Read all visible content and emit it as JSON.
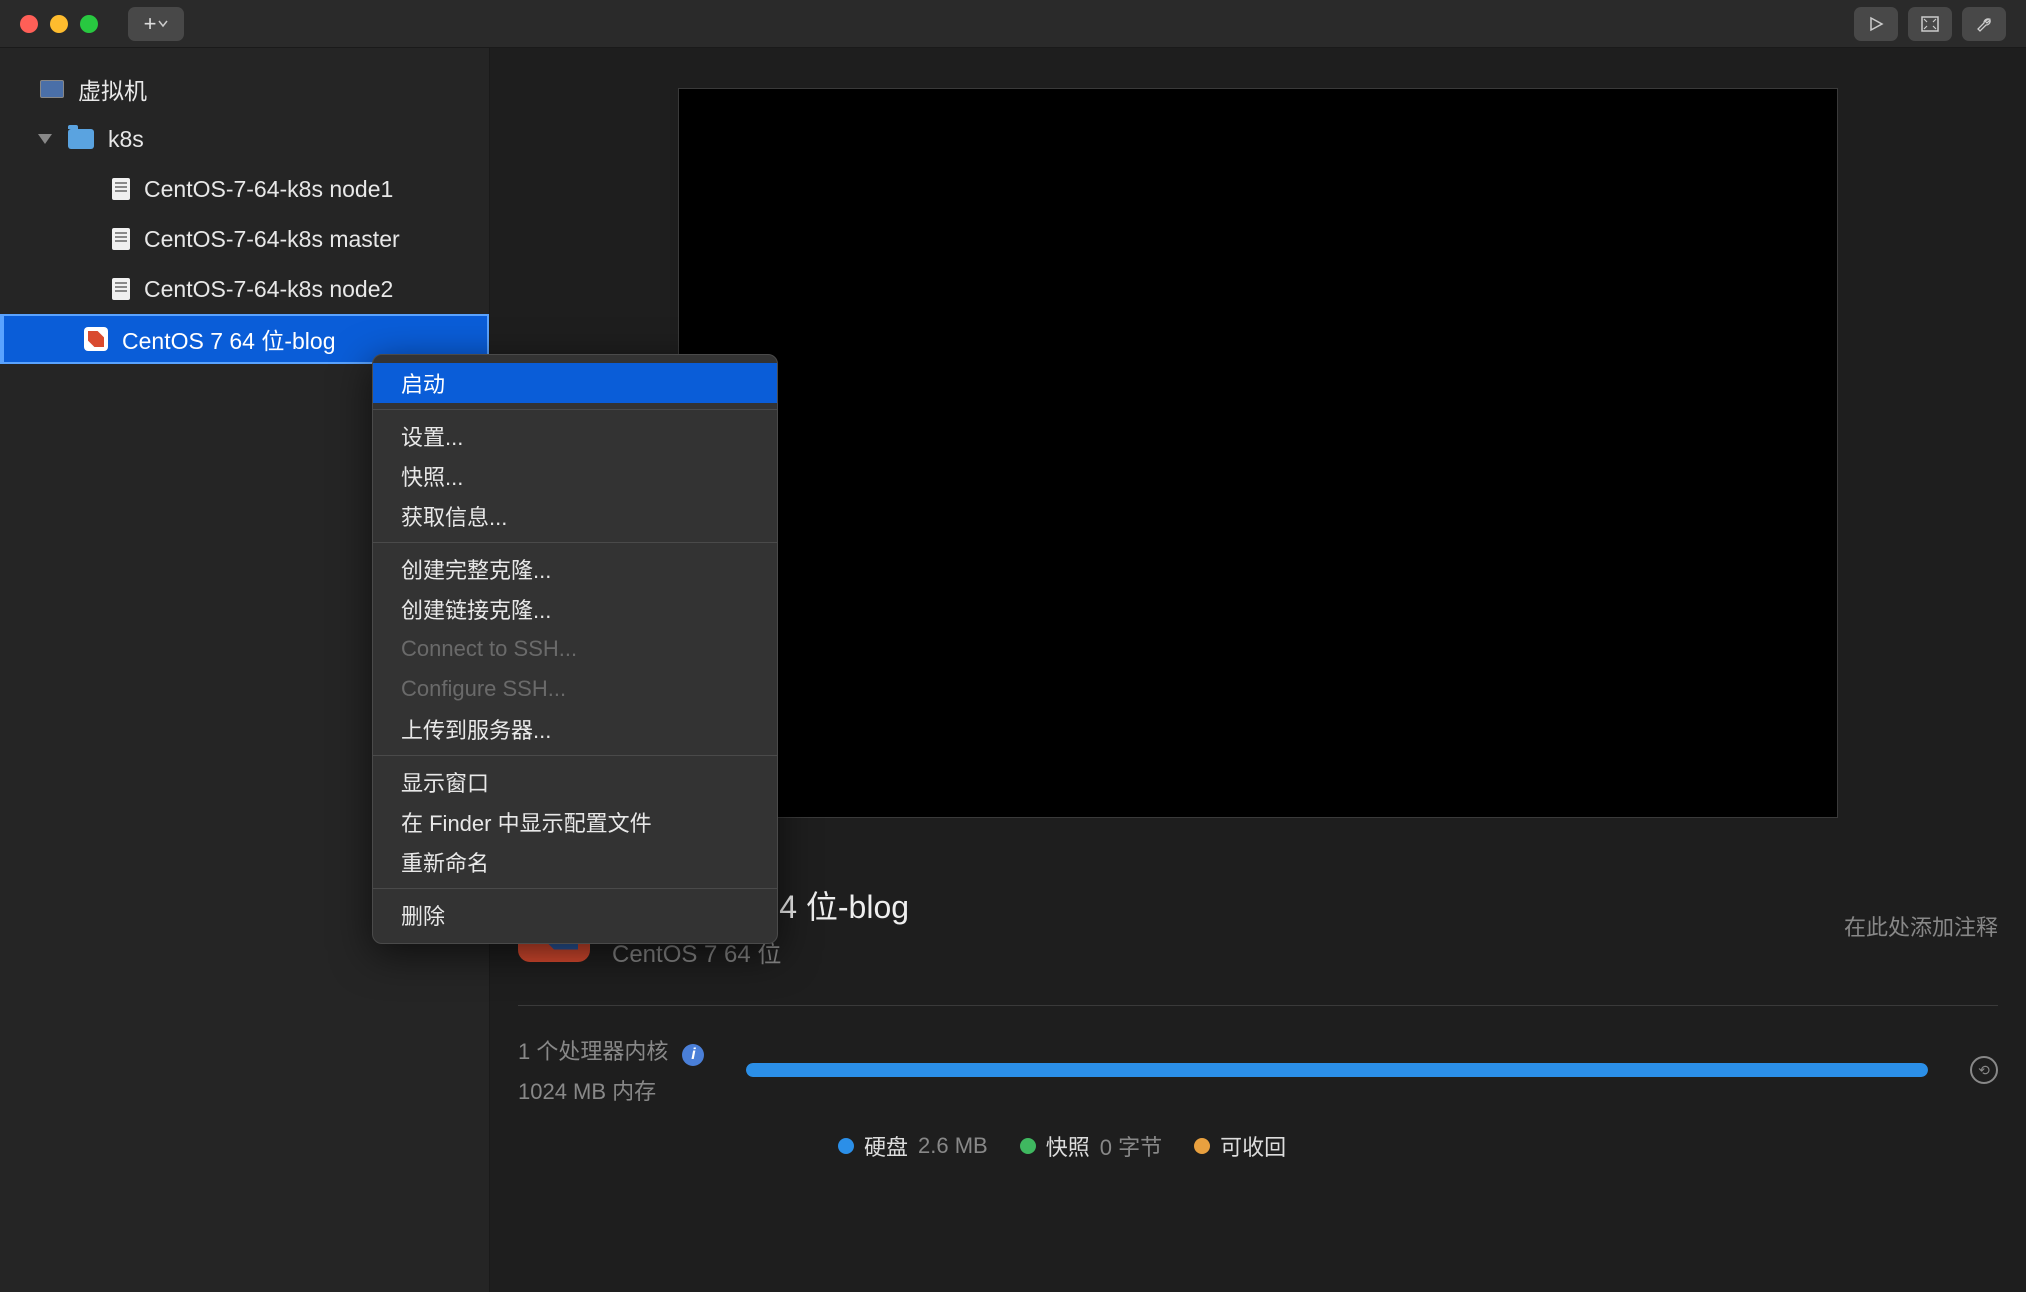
{
  "titlebar": {
    "add_label": "+"
  },
  "sidebar": {
    "root_label": "虚拟机",
    "folder_label": "k8s",
    "vms": [
      "CentOS-7-64-k8s node1",
      "CentOS-7-64-k8s master",
      "CentOS-7-64-k8s node2",
      "CentOS 7 64 位-blog"
    ]
  },
  "context_menu": {
    "start": "启动",
    "settings": "设置...",
    "snapshot": "快照...",
    "get_info": "获取信息...",
    "full_clone": "创建完整克隆...",
    "linked_clone": "创建链接克隆...",
    "connect_ssh": "Connect to SSH...",
    "configure_ssh": "Configure SSH...",
    "upload": "上传到服务器...",
    "show_window": "显示窗口",
    "reveal_finder": "在 Finder 中显示配置文件",
    "rename": "重新命名",
    "delete": "删除"
  },
  "vm_detail": {
    "title": "CentOS 7 64 位-blog",
    "subtitle": "CentOS 7 64 位",
    "note_placeholder": "在此处添加注释",
    "cpu_label": "1 个处理器内核",
    "mem_label": "1024 MB 内存",
    "legend": {
      "disk_label": "硬盘",
      "disk_value": "2.6 MB",
      "snapshot_label": "快照",
      "snapshot_value": "0 字节",
      "reclaimable_label": "可收回"
    }
  }
}
